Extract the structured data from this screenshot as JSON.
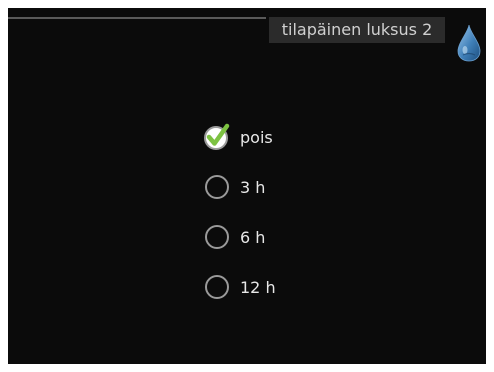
{
  "header": {
    "title": "tilapäinen luksus 2",
    "icon": "water-drop-icon"
  },
  "options": [
    {
      "label": "pois",
      "selected": true
    },
    {
      "label": "3 h",
      "selected": false
    },
    {
      "label": "6 h",
      "selected": false
    },
    {
      "label": "12 h",
      "selected": false
    }
  ],
  "colors": {
    "background": "#0b0b0b",
    "text": "#e8e8e8",
    "check": "#7dc242",
    "radio_ring": "#9a9a9a",
    "drop": "#3f7fb8"
  }
}
